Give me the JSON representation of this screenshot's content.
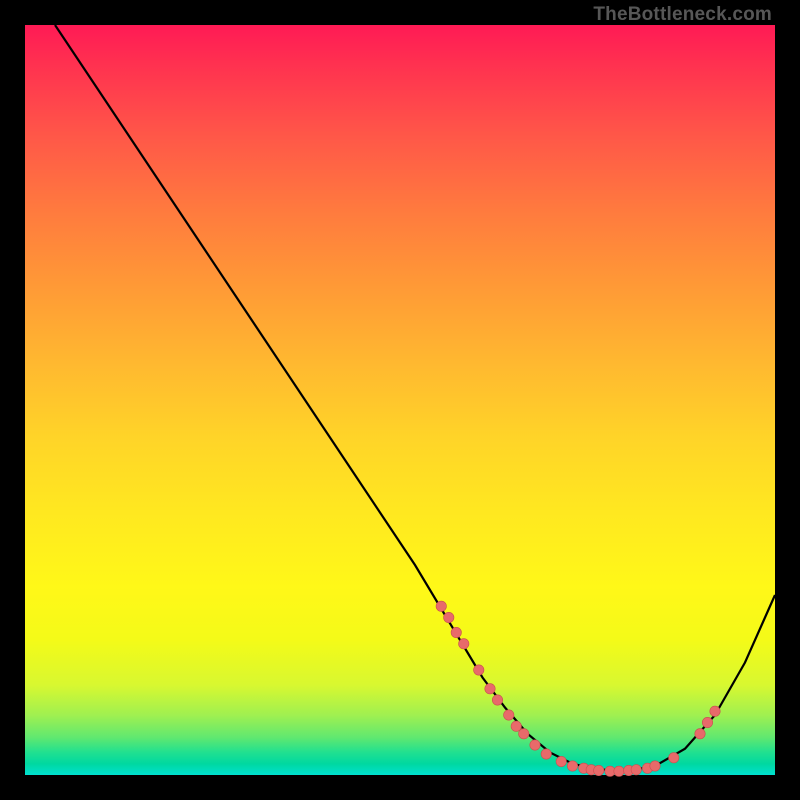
{
  "watermark": "TheBottleneck.com",
  "chart_data": {
    "type": "line",
    "title": "",
    "xlabel": "",
    "ylabel": "",
    "xlim": [
      0,
      100
    ],
    "ylim": [
      0,
      100
    ],
    "curve": {
      "x": [
        4,
        8,
        12,
        16,
        20,
        24,
        28,
        32,
        36,
        40,
        44,
        48,
        52,
        55,
        58,
        61,
        64,
        67,
        70,
        73,
        76,
        80,
        84,
        88,
        92,
        96,
        100
      ],
      "y": [
        100,
        94,
        88,
        82,
        76,
        70,
        64,
        58,
        52,
        46,
        40,
        34,
        28,
        23,
        18,
        13,
        9,
        5.5,
        3,
        1.5,
        0.8,
        0.5,
        1.2,
        3.5,
        8,
        15,
        24
      ]
    },
    "points": [
      {
        "x": 55.5,
        "y": 22.5
      },
      {
        "x": 56.5,
        "y": 21
      },
      {
        "x": 57.5,
        "y": 19
      },
      {
        "x": 58.5,
        "y": 17.5
      },
      {
        "x": 60.5,
        "y": 14
      },
      {
        "x": 62,
        "y": 11.5
      },
      {
        "x": 63,
        "y": 10
      },
      {
        "x": 64.5,
        "y": 8
      },
      {
        "x": 65.5,
        "y": 6.5
      },
      {
        "x": 66.5,
        "y": 5.5
      },
      {
        "x": 68,
        "y": 4
      },
      {
        "x": 69.5,
        "y": 2.8
      },
      {
        "x": 71.5,
        "y": 1.8
      },
      {
        "x": 73,
        "y": 1.2
      },
      {
        "x": 74.5,
        "y": 0.9
      },
      {
        "x": 75.5,
        "y": 0.7
      },
      {
        "x": 76.5,
        "y": 0.6
      },
      {
        "x": 78,
        "y": 0.5
      },
      {
        "x": 79.2,
        "y": 0.5
      },
      {
        "x": 80.5,
        "y": 0.6
      },
      {
        "x": 81.5,
        "y": 0.7
      },
      {
        "x": 83,
        "y": 0.9
      },
      {
        "x": 84,
        "y": 1.2
      },
      {
        "x": 86.5,
        "y": 2.3
      },
      {
        "x": 90,
        "y": 5.5
      },
      {
        "x": 91,
        "y": 7
      },
      {
        "x": 92,
        "y": 8.5
      }
    ],
    "colors": {
      "curve": "#000000",
      "point_fill": "#e86a6a",
      "point_stroke": "#c94f4f"
    }
  }
}
